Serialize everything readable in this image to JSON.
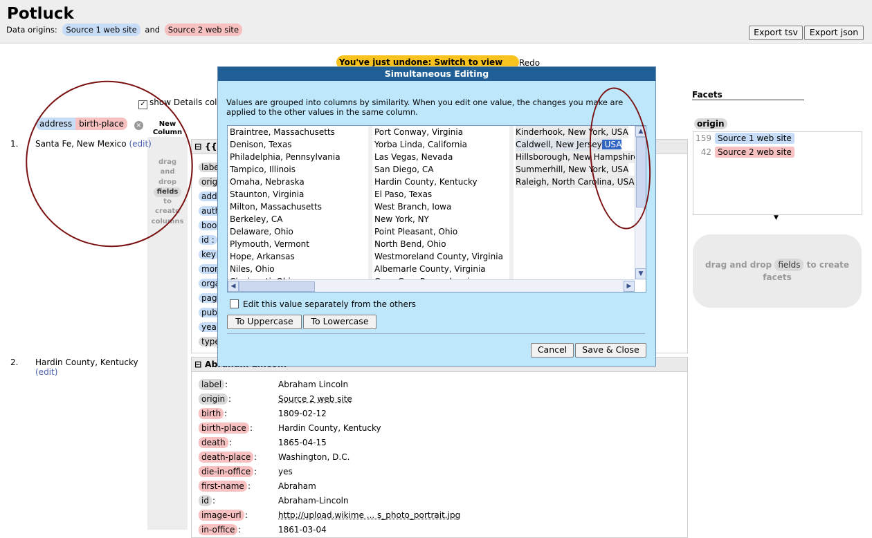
{
  "header": {
    "title": "Potluck",
    "origins_label": "Data origins:",
    "source1": "Source 1 web site",
    "and": "and",
    "source2": "Source 2 web site",
    "export_tsv": "Export tsv",
    "export_json": "Export json"
  },
  "undo": {
    "message": "You've just undone: Switch to view Map",
    "redo": "Redo"
  },
  "controls": {
    "show_details": "show Details colu",
    "column_field1": "address",
    "column_field2": "birth-place"
  },
  "new_column": {
    "label": "New Column",
    "drag_words": [
      "drag",
      "and",
      "drop",
      "fields",
      "to",
      "create",
      "columns"
    ]
  },
  "rows": [
    {
      "num": "1.",
      "value": "Santa Fe, New Mexico",
      "edit": "(edit)",
      "record_title": "{{D",
      "field_stubs": [
        "labe",
        "origi",
        "addr",
        "auth",
        "boo",
        "id :",
        "key",
        "mor",
        "orga",
        "page",
        "pub",
        "year",
        "type"
      ]
    },
    {
      "num": "2.",
      "value": "Hardin County, Kentucky",
      "edit": "(edit)",
      "record_title": "Abraham Lincoln",
      "fields": [
        {
          "name": "label",
          "value": "Abraham Lincoln",
          "color": "gray"
        },
        {
          "name": "origin",
          "value": "Source 2 web site",
          "color": "gray"
        },
        {
          "name": "birth",
          "value": "1809-02-12",
          "color": "red"
        },
        {
          "name": "birth-place",
          "value": "Hardin County, Kentucky",
          "color": "red"
        },
        {
          "name": "death",
          "value": "1865-04-15",
          "color": "red"
        },
        {
          "name": "death-place",
          "value": "Washington, D.C.",
          "color": "red"
        },
        {
          "name": "die-in-office",
          "value": "yes",
          "color": "red"
        },
        {
          "name": "first-name",
          "value": "Abraham",
          "color": "red"
        },
        {
          "name": "id",
          "value": "Abraham-Lincoln",
          "color": "gray"
        },
        {
          "name": "image-url",
          "value": "http://upload.wikime ... s_photo_portrait.jpg",
          "color": "red"
        },
        {
          "name": "in-office",
          "value": "1861-03-04",
          "color": "red"
        }
      ]
    }
  ],
  "facets": {
    "title": "Facets",
    "facet_name": "origin",
    "items": [
      {
        "count": "159",
        "label": "Source 1 web site"
      },
      {
        "count": "42",
        "label": "Source 2 web site"
      }
    ],
    "drop_before": "drag and drop",
    "drop_pill": "fields",
    "drop_after": "to create facets"
  },
  "dialog": {
    "title": "Simultaneous Editing",
    "description": "Values are grouped into columns by similarity. When you edit one value, the changes you make are applied to the other values in the same column.",
    "columns": [
      [
        "Braintree, Massachusetts",
        "Denison, Texas",
        "Philadelphia, Pennsylvania",
        "Tampico, Illinois",
        "Omaha, Nebraska",
        "Staunton, Virginia",
        "Milton, Massachusetts",
        "Berkeley, CA",
        "Delaware, Ohio",
        "Plymouth, Vermont",
        "Hope, Arkansas",
        "Niles, Ohio",
        "Cincinnati, Ohio"
      ],
      [
        "Port Conway, Virginia",
        "Yorba Linda, California",
        "Las Vegas, Nevada",
        "San Diego, CA",
        "Hardin County, Kentucky",
        "El Paso, Texas",
        "West Branch, Iowa",
        "New York, NY",
        "Point Pleasant, Ohio",
        "North Bend, Ohio",
        "Westmoreland County, Virginia",
        "Albemarle County, Virginia",
        "Cove Gap, Pennsylvania"
      ],
      [
        "Kinderhook, New York, USA",
        "Caldwell, New Jersey",
        "Hillsborough, New Hampshire, USA",
        "Summerhill, New York, USA",
        "Raleigh, North Carolina, USA"
      ]
    ],
    "usa_suffix": ", USA",
    "selected_suffix": " USA",
    "checkbox_label": "Edit this value separately from the others",
    "uppercase": "To Uppercase",
    "lowercase": "To Lowercase",
    "cancel": "Cancel",
    "save": "Save & Close"
  }
}
